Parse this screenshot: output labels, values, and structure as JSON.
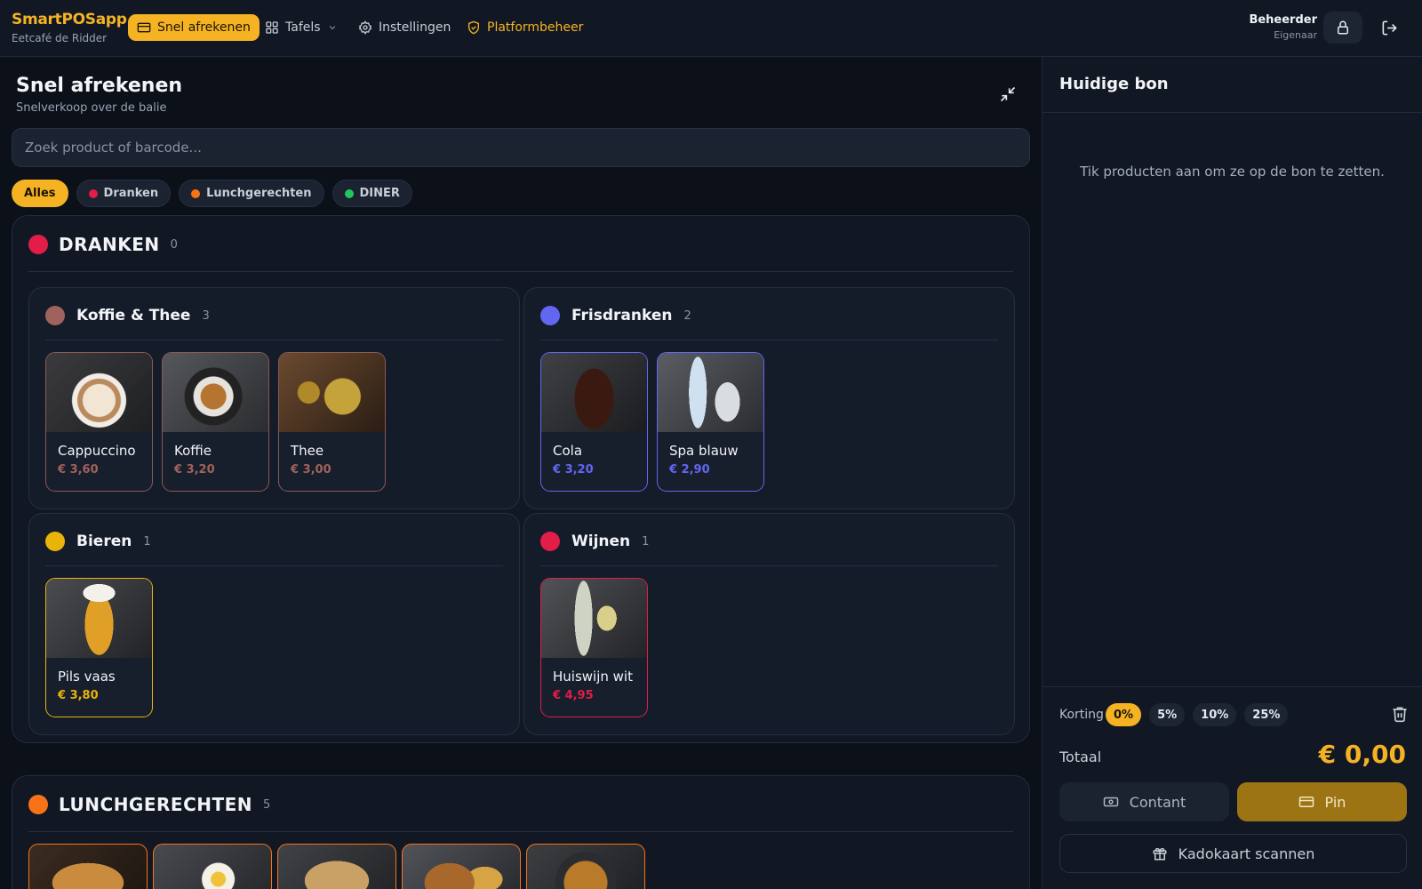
{
  "brand": {
    "name": "SmartPOSapp",
    "venue": "Eetcafé de Ridder"
  },
  "nav": {
    "quick_checkout": "Snel afrekenen",
    "tables": "Tafels",
    "settings": "Instellingen",
    "platform": "Platformbeheer"
  },
  "user": {
    "name": "Beheerder",
    "role": "Eigenaar"
  },
  "page": {
    "title": "Snel afrekenen",
    "subtitle": "Snelverkoop over de balie",
    "search_placeholder": "Zoek product of barcode..."
  },
  "filters": [
    {
      "label": "Alles",
      "active": true
    },
    {
      "label": "Dranken",
      "color": "#e11d48"
    },
    {
      "label": "Lunchgerechten",
      "color": "#f97316"
    },
    {
      "label": "DINER",
      "color": "#22c55e"
    }
  ],
  "sections": {
    "drinks": {
      "title": "DRANKEN",
      "count": "0",
      "color": "#e11d48",
      "groups": [
        {
          "title": "Koffie & Thee",
          "count": "3",
          "color": "#a0625d",
          "products": [
            {
              "name": "Cappuccino",
              "price": "€ 3,60"
            },
            {
              "name": "Koffie",
              "price": "€ 3,20"
            },
            {
              "name": "Thee",
              "price": "€ 3,00"
            }
          ]
        },
        {
          "title": "Frisdranken",
          "count": "2",
          "color": "#6366f1",
          "products": [
            {
              "name": "Cola",
              "price": "€ 3,20"
            },
            {
              "name": "Spa blauw",
              "price": "€ 2,90"
            }
          ]
        },
        {
          "title": "Bieren",
          "count": "1",
          "color": "#eab308",
          "products": [
            {
              "name": "Pils vaas",
              "price": "€ 3,80"
            }
          ]
        },
        {
          "title": "Wijnen",
          "count": "1",
          "color": "#e11d48",
          "products": [
            {
              "name": "Huiswijn wit",
              "price": "€ 4,95"
            }
          ]
        }
      ]
    },
    "lunch": {
      "title": "LUNCHGERECHTEN",
      "count": "5",
      "color": "#f97316"
    }
  },
  "receipt": {
    "title": "Huidige bon",
    "empty": "Tik producten aan om ze op de bon te zetten.",
    "discount_label": "Korting",
    "discounts": [
      "0%",
      "5%",
      "10%",
      "25%"
    ],
    "total_label": "Totaal",
    "total_value": "€ 0,00",
    "cash": "Contant",
    "pin": "Pin",
    "gift": "Kadokaart scannen"
  }
}
